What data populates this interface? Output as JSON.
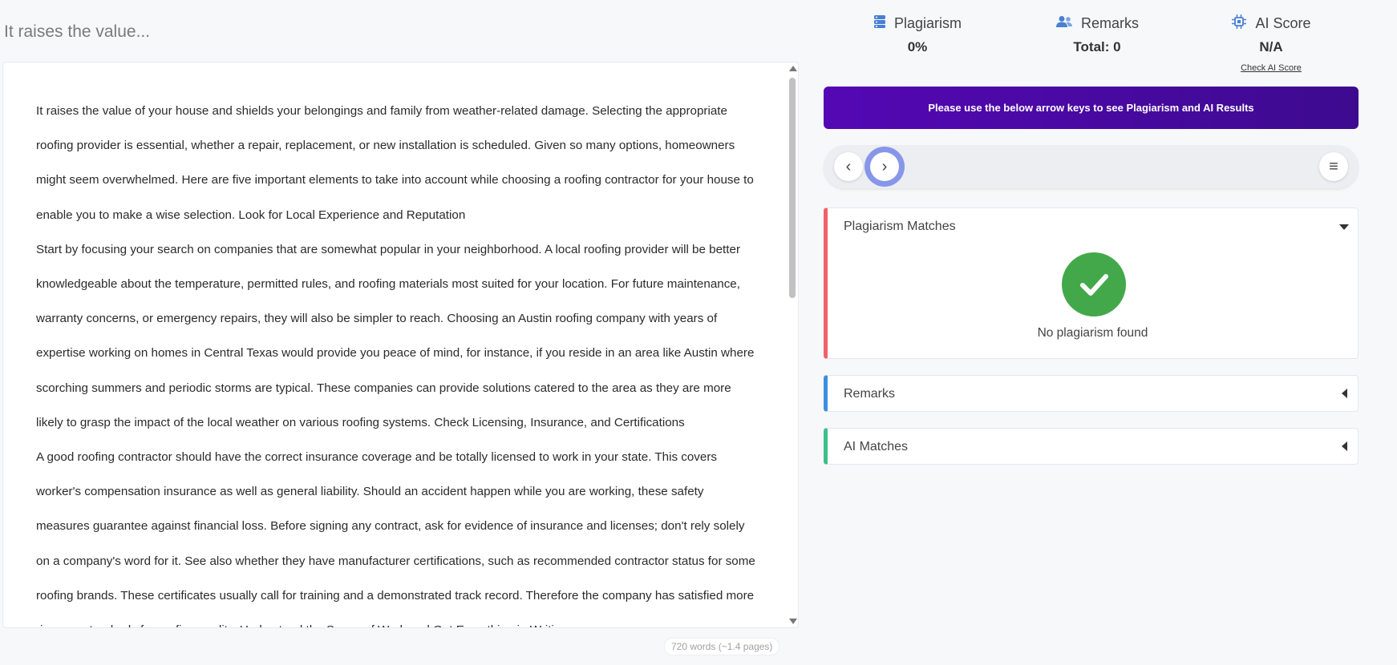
{
  "document": {
    "title": "It raises the value...",
    "paragraphs": [
      "It raises the value of your house and shields your belongings and family from weather-related damage. Selecting the appropriate roofing provider is essential, whether a repair, replacement, or new installation is scheduled. Given so many options, homeowners might seem overwhelmed. Here are five important elements to take into account while choosing a roofing contractor for your house to enable you to make a wise selection. Look for Local Experience and Reputation",
      "Start by focusing your search on companies that are somewhat popular in your neighborhood. A local roofing provider will be better knowledgeable about the temperature, permitted rules, and roofing materials most suited for your location. For future maintenance, warranty concerns, or emergency repairs, they will also be simpler to reach. Choosing an Austin roofing company with years of expertise working on homes in Central Texas would provide you peace of mind, for instance, if you reside in an area like Austin where scorching summers and periodic storms are typical. These companies can provide solutions catered to the area as they are more likely to grasp the impact of the local weather on various roofing systems. Check Licensing, Insurance, and Certifications",
      "A good roofing contractor should have the correct insurance coverage and be totally licensed to work in your state. This covers worker's compensation insurance as well as general liability. Should an accident happen while you are working, these safety measures guarantee against financial loss. Before signing any contract, ask for evidence of insurance and licenses; don't rely solely on a company's word for it. See also whether they have manufacturer certifications, such as recommended contractor status for some roofing brands. These certificates usually call for training and a demonstrated track record. Therefore the company has satisfied more rigorous standards for roofing quality. Understand the Scope of Work and Get Everything in Writing"
    ],
    "word_count": "720 words (~1.4 pages)"
  },
  "stats": {
    "plagiarism": {
      "label": "Plagiarism",
      "value": "0%",
      "icon": "database-icon"
    },
    "remarks": {
      "label": "Remarks",
      "value": "Total: 0",
      "icon": "users-icon"
    },
    "ai_score": {
      "label": "AI Score",
      "value": "N/A",
      "link": "Check AI Score",
      "icon": "chip-icon"
    }
  },
  "banner": "Please use the below arrow keys to see Plagiarism and AI Results",
  "nav": {
    "prev": "‹",
    "next": "›",
    "menu": "≡"
  },
  "cards": {
    "plagiarism": {
      "title": "Plagiarism Matches",
      "empty": "No plagiarism found"
    },
    "remarks": {
      "title": "Remarks"
    },
    "ai": {
      "title": "AI Matches"
    }
  },
  "colors": {
    "banner_start": "#5408b4",
    "banner_end": "#3d0a8f",
    "plagiarism_accent": "#f1616b",
    "remarks_accent": "#3b8fe0",
    "ai_accent": "#3cbf8a",
    "success": "#43a84a",
    "icon_blue": "#4a7fd4"
  }
}
